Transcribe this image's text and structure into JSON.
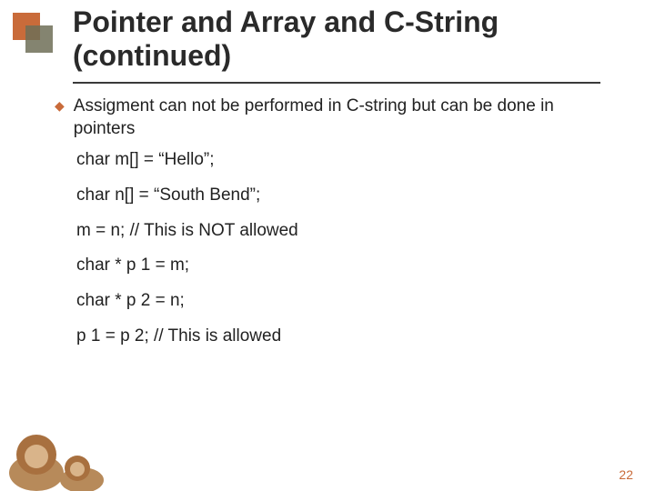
{
  "title_line1": "Pointer and Array and C-String",
  "title_line2": "(continued)",
  "bullet": "Assigment can not be performed in C-string but can be done in pointers",
  "code": {
    "line1": "char m[] = “Hello”;",
    "line2": "char n[] = “South Bend”;",
    "line3": "m = n; // This is NOT allowed",
    "line4": "char * p 1 = m;",
    "line5": "char * p 2 = n;",
    "line6": "p 1 = p 2; // This is allowed"
  },
  "page_number": "22",
  "colors": {
    "accent": "#c96b3a",
    "text": "#2a2a2a"
  }
}
